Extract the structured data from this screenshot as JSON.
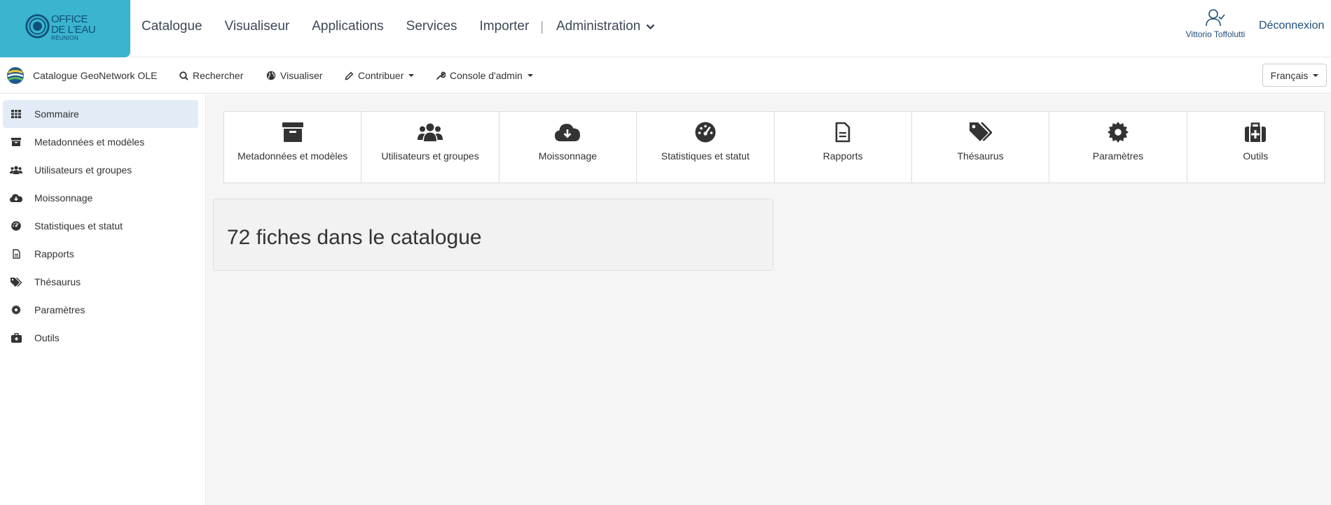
{
  "header": {
    "logo": {
      "line1": "OFFICE",
      "line2": "DE L'EAU",
      "line3": "RÉUNION",
      "color": "#3bb4cf"
    },
    "nav": [
      "Catalogue",
      "Visualiseur",
      "Applications",
      "Services",
      "Importer"
    ],
    "separator": "|",
    "admin_label": "Administration",
    "user_name": "Vittorio Toffolutti",
    "logout_label": "Déconnexion"
  },
  "subnav": {
    "brand": "Catalogue GeoNetwork OLE",
    "search": "Rechercher",
    "map": "Visualiser",
    "contribute": "Contribuer",
    "admin_console": "Console d'admin",
    "language": "Français"
  },
  "sidebar": {
    "items": [
      {
        "label": "Sommaire",
        "icon": "grid-icon",
        "active": true
      },
      {
        "label": "Metadonnées et modèles",
        "icon": "archive-icon"
      },
      {
        "label": "Utilisateurs et groupes",
        "icon": "users-icon"
      },
      {
        "label": "Moissonnage",
        "icon": "cloud-download-icon"
      },
      {
        "label": "Statistiques et statut",
        "icon": "dashboard-icon"
      },
      {
        "label": "Rapports",
        "icon": "file-icon"
      },
      {
        "label": "Thésaurus",
        "icon": "tags-icon"
      },
      {
        "label": "Paramètres",
        "icon": "gear-icon"
      },
      {
        "label": "Outils",
        "icon": "medkit-icon"
      }
    ]
  },
  "tiles": [
    {
      "label": "Metadonnées et modèles",
      "icon": "archive-icon"
    },
    {
      "label": "Utilisateurs et groupes",
      "icon": "users-icon"
    },
    {
      "label": "Moissonnage",
      "icon": "cloud-download-icon"
    },
    {
      "label": "Statistiques et statut",
      "icon": "dashboard-icon"
    },
    {
      "label": "Rapports",
      "icon": "file-icon"
    },
    {
      "label": "Thésaurus",
      "icon": "tags-icon"
    },
    {
      "label": "Paramètres",
      "icon": "gear-icon"
    },
    {
      "label": "Outils",
      "icon": "medkit-icon"
    }
  ],
  "summary": {
    "text": "72 fiches dans le catalogue"
  },
  "colors": {
    "accent": "#3bb4cf",
    "active_bg": "#e3ecf6",
    "link": "#1f4e79"
  }
}
